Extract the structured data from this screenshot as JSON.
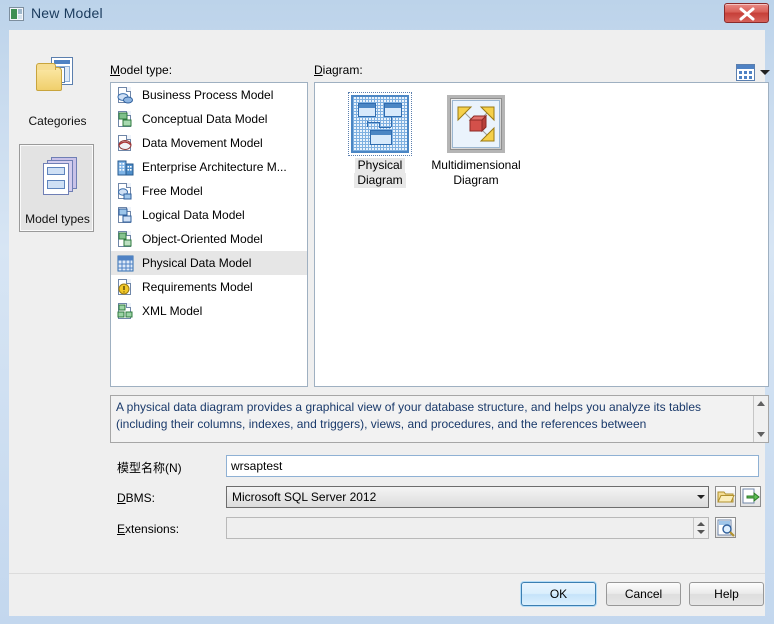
{
  "window": {
    "title": "New Model",
    "icon": "app-window-icon",
    "close_label": "x"
  },
  "sidebar": {
    "items": [
      {
        "label": "Categories",
        "icon": "categories-folder-icon",
        "selected": false
      },
      {
        "label": "Model types",
        "icon": "model-types-stack-icon",
        "selected": true
      }
    ]
  },
  "labels": {
    "model_type": "Model type:",
    "model_type_accel": "M",
    "diagram": "Diagram:",
    "diagram_accel": "D"
  },
  "model_types": {
    "items": [
      {
        "label": "Business Process Model",
        "icon": "business-process-icon",
        "selected": false
      },
      {
        "label": "Conceptual Data Model",
        "icon": "conceptual-data-icon",
        "selected": false
      },
      {
        "label": "Data Movement Model",
        "icon": "data-movement-icon",
        "selected": false
      },
      {
        "label": "Enterprise Architecture M...",
        "icon": "enterprise-architecture-icon",
        "selected": false
      },
      {
        "label": "Free Model",
        "icon": "free-model-icon",
        "selected": false
      },
      {
        "label": "Logical Data Model",
        "icon": "logical-data-icon",
        "selected": false
      },
      {
        "label": "Object-Oriented Model",
        "icon": "object-oriented-icon",
        "selected": false
      },
      {
        "label": "Physical Data Model",
        "icon": "physical-data-icon",
        "selected": true
      },
      {
        "label": "Requirements Model",
        "icon": "requirements-icon",
        "selected": false
      },
      {
        "label": "XML Model",
        "icon": "xml-model-icon",
        "selected": false
      }
    ]
  },
  "diagrams": {
    "items": [
      {
        "label_line1": "Physical",
        "label_line2": "Diagram",
        "icon": "physical-diagram-icon",
        "selected": true
      },
      {
        "label_line1": "Multidimensional",
        "label_line2": "Diagram",
        "icon": "multidimensional-diagram-icon",
        "selected": false
      }
    ],
    "view_switch_icon": "list-view-icon"
  },
  "description": {
    "text": "A physical data diagram provides a graphical view of your database structure, and helps you analyze its tables (including their columns, indexes, and triggers), views, and procedures, and the references between"
  },
  "form": {
    "model_name_label": "模型名称(N)",
    "model_name_value": "wrsaptest",
    "dbms_label": "DBMS:",
    "dbms_accel": "D",
    "dbms_value": "Microsoft SQL Server 2012",
    "extensions_label": "Extensions:",
    "extensions_accel": "E",
    "extensions_value": "",
    "browse_button_icon": "folder-open-icon",
    "share_button_icon": "page-arrow-icon",
    "preview_button_icon": "magnifier-page-icon"
  },
  "buttons": {
    "ok": "OK",
    "cancel": "Cancel",
    "help": "Help"
  },
  "colors": {
    "titlebar": "#cadcef",
    "dialog_bg": "#efefef",
    "selection": "#e6e6e6",
    "accent": "#4f82c4",
    "description_text": "#1a3a6b",
    "close_button": "#c63f38"
  }
}
